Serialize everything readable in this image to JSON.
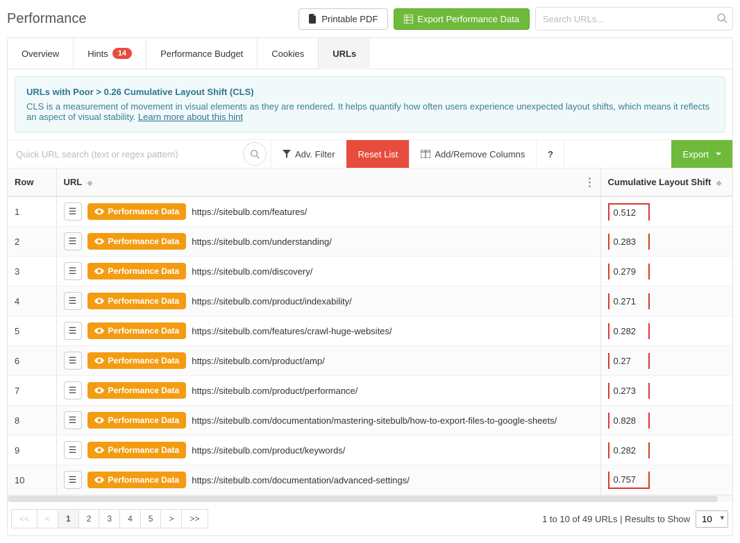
{
  "header": {
    "title": "Performance",
    "printable_label": "Printable PDF",
    "export_label": "Export Performance Data",
    "search_placeholder": "Search URLs..."
  },
  "tabs": [
    {
      "key": "overview",
      "label": "Overview"
    },
    {
      "key": "hints",
      "label": "Hints",
      "badge": "14"
    },
    {
      "key": "budget",
      "label": "Performance Budget"
    },
    {
      "key": "cookies",
      "label": "Cookies"
    },
    {
      "key": "urls",
      "label": "URLs",
      "active": true
    }
  ],
  "hint": {
    "title": "URLs with Poor > 0.26 Cumulative Layout Shift (CLS)",
    "body": "CLS is a measurement of movement in visual elements as they are rendered. It helps quantify how often users experience unexpected layout shifts, which means it reflects an aspect of visual stability. ",
    "link_label": "Learn more about this hint"
  },
  "toolbar": {
    "quick_search_placeholder": "Quick URL search (text or regex pattern)",
    "adv_filter": "Adv. Filter",
    "reset": "Reset List",
    "columns": "Add/Remove Columns",
    "help": "?",
    "export": "Export"
  },
  "table": {
    "headers": {
      "row": "Row",
      "url": "URL",
      "cls": "Cumulative Layout Shift"
    },
    "perf_btn": "Performance Data",
    "rows": [
      {
        "n": 1,
        "url": "https://sitebulb.com/features/",
        "cls": "0.512"
      },
      {
        "n": 2,
        "url": "https://sitebulb.com/understanding/",
        "cls": "0.283"
      },
      {
        "n": 3,
        "url": "https://sitebulb.com/discovery/",
        "cls": "0.279"
      },
      {
        "n": 4,
        "url": "https://sitebulb.com/product/indexability/",
        "cls": "0.271"
      },
      {
        "n": 5,
        "url": "https://sitebulb.com/features/crawl-huge-websites/",
        "cls": "0.282"
      },
      {
        "n": 6,
        "url": "https://sitebulb.com/product/amp/",
        "cls": "0.27"
      },
      {
        "n": 7,
        "url": "https://sitebulb.com/product/performance/",
        "cls": "0.273"
      },
      {
        "n": 8,
        "url": "https://sitebulb.com/documentation/mastering-sitebulb/how-to-export-files-to-google-sheets/",
        "cls": "0.828"
      },
      {
        "n": 9,
        "url": "https://sitebulb.com/product/keywords/",
        "cls": "0.282"
      },
      {
        "n": 10,
        "url": "https://sitebulb.com/documentation/advanced-settings/",
        "cls": "0.757"
      }
    ]
  },
  "pagination": {
    "pages": [
      "<<",
      "<",
      "1",
      "2",
      "3",
      "4",
      "5",
      ">",
      ">>"
    ],
    "active": "1",
    "summary": "1 to 10 of 49 URLs | Results to Show",
    "per_page": "10"
  }
}
